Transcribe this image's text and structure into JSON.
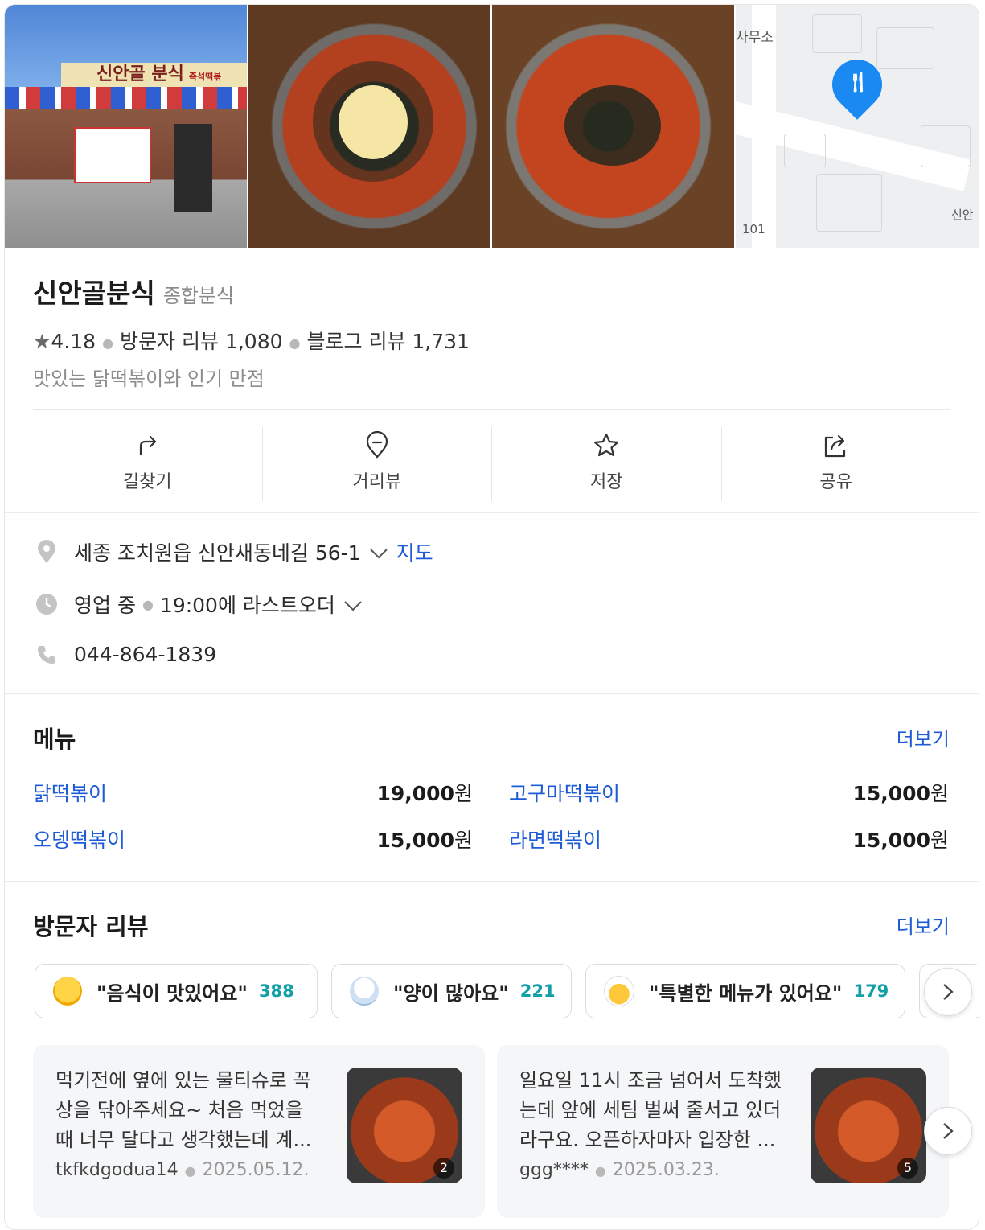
{
  "place": {
    "name": "신안골분식",
    "category": "종합분식",
    "rating": "4.18",
    "visitor_reviews": "방문자 리뷰 1,080",
    "blog_reviews": "블로그 리뷰 1,731",
    "description": "맛있는 닭떡볶이와 인기 만점"
  },
  "photos": {
    "sign_text": "신안골 분식",
    "sign_small": "즉석떡볶 T.864",
    "map_labels": [
      "사무소",
      "101",
      "신안"
    ]
  },
  "actions": [
    {
      "label": "길찾기",
      "icon": "directions-arrow-icon"
    },
    {
      "label": "거리뷰",
      "icon": "location-pin-outline-icon"
    },
    {
      "label": "저장",
      "icon": "star-outline-icon"
    },
    {
      "label": "공유",
      "icon": "share-icon"
    }
  ],
  "info": {
    "address": "세종 조치원읍 신안새동네길 56-1",
    "map_link": "지도",
    "status": "영업 중",
    "hours": "19:00에 라스트오더",
    "phone": "044-864-1839"
  },
  "menu": {
    "title": "메뉴",
    "more": "더보기",
    "items": [
      {
        "name": "닭떡볶이",
        "price": "19,000",
        "unit": "원"
      },
      {
        "name": "고구마떡볶이",
        "price": "15,000",
        "unit": "원"
      },
      {
        "name": "오뎅떡볶이",
        "price": "15,000",
        "unit": "원"
      },
      {
        "name": "라면떡볶이",
        "price": "15,000",
        "unit": "원"
      }
    ]
  },
  "reviews": {
    "title": "방문자 리뷰",
    "more": "더보기",
    "keywords": [
      {
        "text": "\"음식이 맛있어요\"",
        "count": "388"
      },
      {
        "text": "\"양이 많아요\"",
        "count": "221"
      },
      {
        "text": "\"특별한 메뉴가 있어요\"",
        "count": "179"
      }
    ],
    "items": [
      {
        "text": "먹기전에 옆에 있는 물티슈로 꼭 상을 닦아주세요~ 처음 먹었을 때 너무 달다고 생각했는데 계...",
        "author": "tkfkdgodua14",
        "date": "2025.05.12.",
        "photo_count": "2"
      },
      {
        "text": "일요일 11시 조금 넘어서 도착했는데 앞에 세팀 벌써 줄서고 있더라구요. 오픈하자마자 입장한 ...",
        "author": "ggg****",
        "date": "2025.03.23.",
        "photo_count": "5"
      }
    ]
  },
  "colors": {
    "link": "#1e5bd6",
    "count": "#12a0a8",
    "pin": "#1a8af2"
  }
}
